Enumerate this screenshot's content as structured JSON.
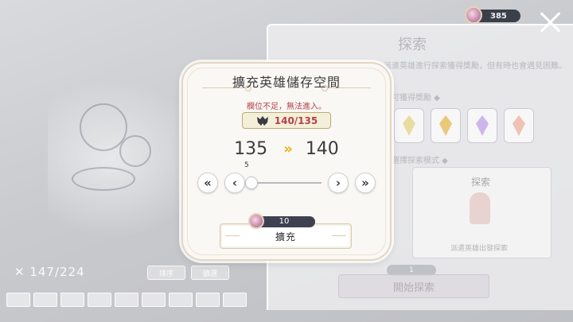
{
  "hud": {
    "currency_value": "385",
    "currency_icon": "gem-coin-icon",
    "close_icon": "close-icon"
  },
  "background": {
    "explore_title": "探索",
    "explore_subtitle": "派遣英雄進行探索獲得獎勵，但有時也會遇見困難。",
    "reward_label": "可獲得獎勵 ◆",
    "crystal_colors": [
      "#e8dca0",
      "#e9c97a",
      "#cdb7ea",
      "#efc3b3",
      "#c9d9f0"
    ],
    "mode_label": "選擇探索模式 ◆",
    "mode_card_title": "探索",
    "mode_card_desc": "派遣英雄出發探索",
    "start_cost": "1",
    "start_button": "開始探索",
    "hero_count": "147/224",
    "sort_button": "排序",
    "filter_button": "篩選"
  },
  "dialog": {
    "title": "擴充英雄儲存空間",
    "warning": "欄位不足，無法進入。",
    "capacity": "140/135",
    "upgrade_from": "135",
    "upgrade_arrow": "»",
    "upgrade_to": "140",
    "slider_value": "5",
    "slider_level": 0.0,
    "btn_min": "«",
    "btn_dec": "‹",
    "btn_inc": "›",
    "btn_max": "»",
    "cost": "10",
    "expand_label": "擴充"
  },
  "colors": {
    "warning": "#b4414a",
    "arrow": "#e6b312",
    "dialog_border": "#e3d7bf"
  }
}
